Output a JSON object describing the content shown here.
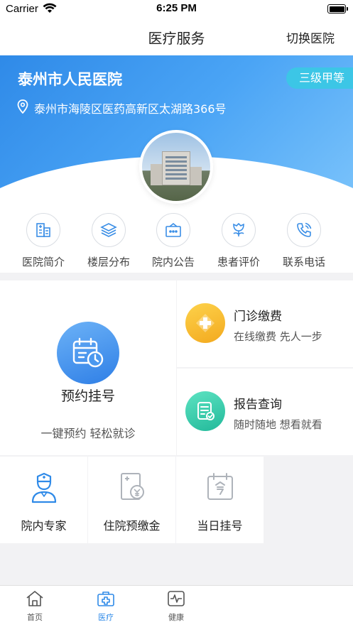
{
  "status_bar": {
    "carrier": "Carrier",
    "time": "6:25 PM"
  },
  "nav": {
    "title": "医疗服务",
    "right_action": "切换医院"
  },
  "hospital": {
    "name": "泰州市人民医院",
    "grade": "三级甲等",
    "address": "泰州市海陵区医药高新区太湖路366号"
  },
  "quick_menu": [
    {
      "label": "医院简介",
      "icon": "hospital-building-icon"
    },
    {
      "label": "楼层分布",
      "icon": "layers-icon"
    },
    {
      "label": "院内公告",
      "icon": "notice-board-icon"
    },
    {
      "label": "患者评价",
      "icon": "flower-icon"
    },
    {
      "label": "联系电话",
      "icon": "phone-icon"
    }
  ],
  "booking": {
    "title": "预约挂号",
    "subtitle": "一键预约 轻松就诊",
    "icon": "calendar-clock-icon"
  },
  "pay": {
    "title": "门诊缴费",
    "subtitle": "在线缴费 先人一步",
    "icon": "medical-cross-icon"
  },
  "report": {
    "title": "报告查询",
    "subtitle": "随时随地 想看就看",
    "icon": "report-icon"
  },
  "small_cards": [
    {
      "label": "院内专家",
      "icon": "doctor-icon"
    },
    {
      "label": "住院预缴金",
      "icon": "deposit-icon"
    },
    {
      "label": "当日挂号",
      "icon": "today-calendar-icon"
    }
  ],
  "tabs": [
    {
      "label": "首页",
      "icon": "home-icon",
      "active": false
    },
    {
      "label": "医疗",
      "icon": "medical-kit-icon",
      "active": true
    },
    {
      "label": "健康",
      "icon": "health-monitor-icon",
      "active": false
    }
  ],
  "colors": {
    "primary": "#2f8ae8",
    "badge": "#3cc6e6",
    "pay_icon": "#f6bb2b",
    "report_icon": "#2fcaa5"
  }
}
